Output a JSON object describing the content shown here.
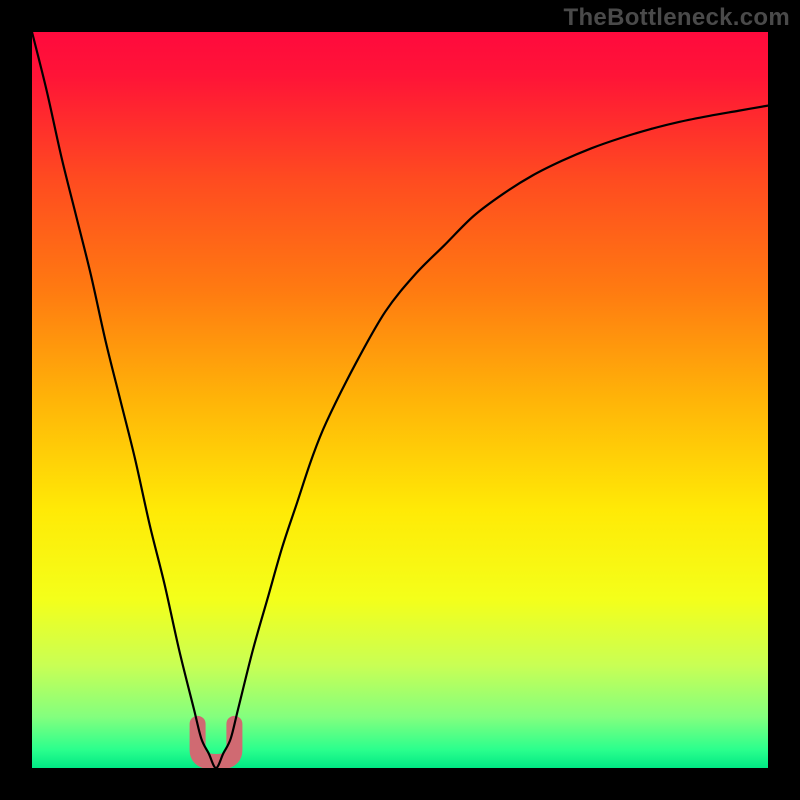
{
  "watermark": "TheBottleneck.com",
  "chart_data": {
    "type": "line",
    "title": "",
    "xlabel": "",
    "ylabel": "",
    "xlim": [
      0,
      100
    ],
    "ylim": [
      0,
      100
    ],
    "series": [
      {
        "name": "bottleneck-curve",
        "x": [
          0,
          2,
          4,
          6,
          8,
          10,
          12,
          14,
          16,
          18,
          20,
          22,
          23,
          24,
          25,
          26,
          27,
          28,
          30,
          32,
          34,
          36,
          38,
          40,
          44,
          48,
          52,
          56,
          60,
          64,
          68,
          72,
          76,
          80,
          84,
          88,
          92,
          96,
          100
        ],
        "y": [
          100,
          92,
          83,
          75,
          67,
          58,
          50,
          42,
          33,
          25,
          16,
          8,
          4,
          2,
          0,
          2,
          4,
          8,
          16,
          23,
          30,
          36,
          42,
          47,
          55,
          62,
          67,
          71,
          75,
          78,
          80.5,
          82.5,
          84.2,
          85.6,
          86.8,
          87.8,
          88.6,
          89.3,
          90
        ]
      }
    ],
    "annotations": [
      {
        "name": "trough-marker",
        "x_range": [
          22.5,
          27.5
        ],
        "y_range": [
          0,
          6
        ],
        "color": "#d06a72"
      }
    ],
    "background_gradient": {
      "stops": [
        {
          "offset": 0.0,
          "color": "#ff0a3d"
        },
        {
          "offset": 0.06,
          "color": "#ff1437"
        },
        {
          "offset": 0.2,
          "color": "#ff4b20"
        },
        {
          "offset": 0.35,
          "color": "#ff7a11"
        },
        {
          "offset": 0.5,
          "color": "#ffb408"
        },
        {
          "offset": 0.65,
          "color": "#ffea06"
        },
        {
          "offset": 0.77,
          "color": "#f4ff1a"
        },
        {
          "offset": 0.86,
          "color": "#c9ff54"
        },
        {
          "offset": 0.93,
          "color": "#84ff7e"
        },
        {
          "offset": 0.975,
          "color": "#2bff8d"
        },
        {
          "offset": 1.0,
          "color": "#00e884"
        }
      ]
    }
  }
}
